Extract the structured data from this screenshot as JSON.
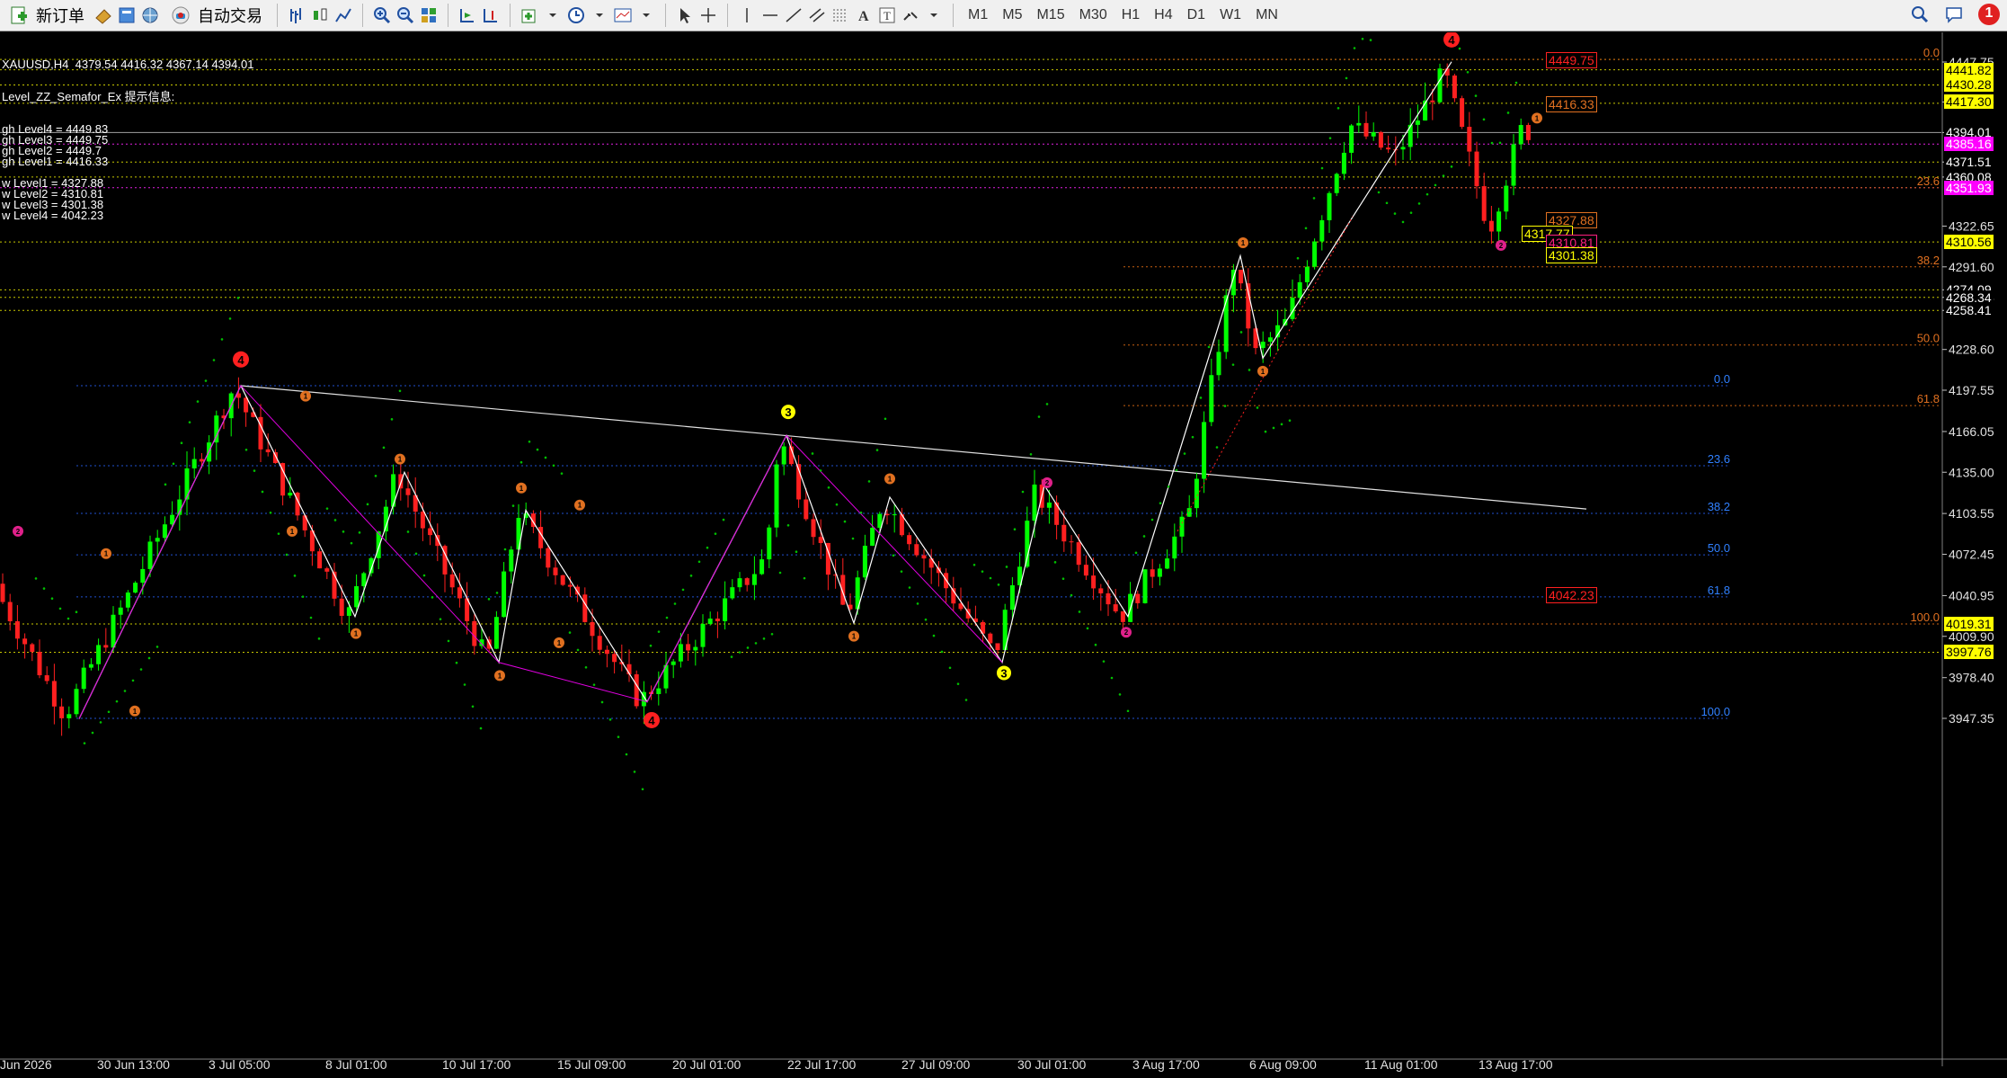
{
  "toolbar": {
    "new_order": "新订单",
    "auto_trading": "自动交易",
    "timeframes": [
      "M1",
      "M5",
      "M15",
      "M30",
      "H1",
      "H4",
      "D1",
      "W1",
      "MN"
    ],
    "notification_count": "1"
  },
  "chart": {
    "info_line": "XAUUSD,H4  4379.54 4416.32 4367.14 4394.01",
    "indicator_name": "Level_ZZ_Semafor_Ex 提示信息:",
    "levels_text": [
      "gh Level4 = 4449.83",
      "gh Level3 = 4449.75",
      "gh Level2 = 4449.7",
      "gh Level1 = 4416.33",
      "",
      "w Level1 = 4327.88",
      "w Level2 = 4310.81",
      "w Level3 = 4301.38",
      "w Level4 = 4042.23"
    ],
    "price_axis": [
      "4447.75",
      "4417.30",
      "4394.01",
      "4371.51",
      "4360.08",
      "4322.65",
      "4291.60",
      "4274.09",
      "4268.34",
      "4258.41",
      "4228.60",
      "4197.55",
      "4166.05",
      "4135.00",
      "4103.55",
      "4072.45",
      "4040.95",
      "4009.90",
      "3978.40",
      "3947.35"
    ],
    "highlight_tags": [
      {
        "text": "4441.82",
        "bg": "#ffff00",
        "fg": "#000000"
      },
      {
        "text": "4430.28",
        "bg": "#ffff00",
        "fg": "#000000"
      },
      {
        "text": "4417.30",
        "bg": "#ffff00",
        "fg": "#000000"
      },
      {
        "text": "4394.01",
        "bg": "#000000",
        "fg": "#ffffff"
      },
      {
        "text": "4385.16",
        "bg": "#ff00ff",
        "fg": "#ffffff"
      },
      {
        "text": "4371.51",
        "bg": "#000000",
        "fg": "#ffffff"
      },
      {
        "text": "4360.08",
        "bg": "#000000",
        "fg": "#ffffff"
      },
      {
        "text": "4351.93",
        "bg": "#ff00ff",
        "fg": "#ffffff"
      },
      {
        "text": "4310.56",
        "bg": "#ffff00",
        "fg": "#000000"
      },
      {
        "text": "4274.09",
        "bg": "#000000",
        "fg": "#ffffff"
      },
      {
        "text": "4268.34",
        "bg": "#000000",
        "fg": "#ffffff"
      },
      {
        "text": "4258.41",
        "bg": "#000000",
        "fg": "#ffffff"
      },
      {
        "text": "4019.31",
        "bg": "#ffff00",
        "fg": "#000000"
      },
      {
        "text": "3997.76",
        "bg": "#ffff00",
        "fg": "#000000"
      }
    ],
    "level_labels": [
      {
        "text": "4449.75",
        "color": "#ff2020"
      },
      {
        "text": "4416.33",
        "color": "#e07020"
      },
      {
        "text": "4327.88",
        "color": "#e07020"
      },
      {
        "text": "4317.77",
        "color": "#ffff00"
      },
      {
        "text": "4310.81",
        "color": "#ff2080"
      },
      {
        "text": "4301.38",
        "color": "#ffff00"
      },
      {
        "text": "4042.23",
        "color": "#ff2020"
      }
    ],
    "fib_top": [
      "0.0",
      "23.6",
      "38.2",
      "50.0",
      "61.8",
      "100.0"
    ],
    "fib_bottom": [
      "0.0",
      "23.6",
      "38.2",
      "50.0",
      "61.8",
      "100.0"
    ],
    "time_axis": [
      "Jun 2026",
      "30 Jun 13:00",
      "3 Jul 05:00",
      "8 Jul 01:00",
      "10 Jul 17:00",
      "15 Jul 09:00",
      "20 Jul 01:00",
      "22 Jul 17:00",
      "27 Jul 09:00",
      "30 Jul 01:00",
      "3 Aug 17:00",
      "6 Aug 09:00",
      "11 Aug 01:00",
      "13 Aug 17:00"
    ],
    "semafor_markers": [
      {
        "label": "4",
        "color": "#ff2020"
      },
      {
        "label": "3",
        "color": "#ffff00"
      },
      {
        "label": "2",
        "color": "#e0208a"
      },
      {
        "label": "1",
        "color": "#e07020"
      }
    ]
  }
}
